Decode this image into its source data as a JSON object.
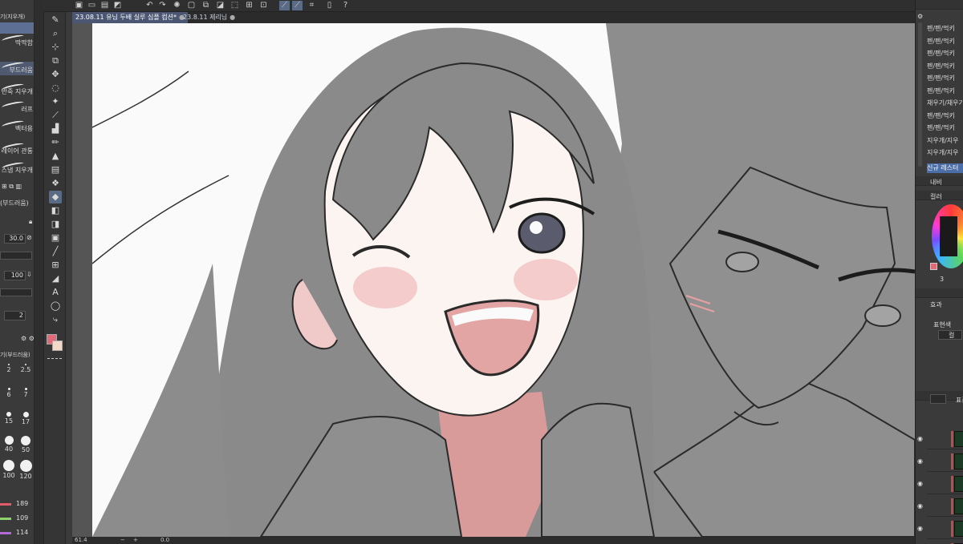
{
  "tabs": [
    {
      "label": "23.08.11 유님 두배 실루 심플 컴션",
      "modified": "*",
      "active": true
    },
    {
      "label": "23.8.11 제리님",
      "modified": "",
      "active": false
    }
  ],
  "left_panel": {
    "header": "기(지우개)",
    "brushes": [
      "딱딱함",
      "부드러움",
      "반죽 지우개",
      "러프",
      "벡터용",
      "레이어 관통",
      "스냅 지우개"
    ],
    "active_brush": "부드러움",
    "tool_label": "(부드러움)",
    "brush_size": "30.0",
    "opacity": "100",
    "hardness": "2",
    "size_group_label": "기(부드러움)",
    "sizes": [
      "2",
      "2.5",
      "6",
      "7",
      "15",
      "17",
      "40",
      "50",
      "100",
      "120"
    ],
    "color_values": [
      {
        "value": "189",
        "color": "#e25b6a"
      },
      {
        "value": "109",
        "color": "#8ed06e"
      },
      {
        "value": "114",
        "color": "#b46ad6"
      }
    ]
  },
  "tools": [
    "pen-icon",
    "zoom-icon",
    "move-icon",
    "layer-move-icon",
    "operation-icon",
    "lasso-icon",
    "magic-wand-icon",
    "eyedropper-icon",
    "pen-tool-icon",
    "pencil-icon",
    "brush-icon",
    "airbrush-icon",
    "decoration-icon",
    "eraser-icon",
    "blend-icon",
    "fill-icon",
    "gradient-icon",
    "ruler-icon",
    "frame-icon",
    "figure-icon",
    "text-icon",
    "balloon-icon",
    "correct-line-icon"
  ],
  "status": {
    "zoom": "61.4",
    "angle": "0.0"
  },
  "right_panel": {
    "layer_sets": [
      "펜/펜/먹키",
      "펜/펜/먹키",
      "펜/펜/먹키",
      "펜/펜/먹키",
      "펜/펜/먹키",
      "펜/펜/먹키",
      "채우기/채우기",
      "펜/펜/먹키",
      "펜/펜/먹키",
      "지우개/지우",
      "지우개/지우"
    ],
    "selected_set": "신규 레스터",
    "nav_label": "내비",
    "color_label": "컬러",
    "size_label": "3",
    "effect_label": "효과",
    "expression_label": "표현색",
    "expression_value": "컬",
    "layer_mode": "표준"
  },
  "colors": {
    "main_color": "#e06a78",
    "sub_color": "#f2d8c8",
    "accent": "#4b6ea8"
  }
}
